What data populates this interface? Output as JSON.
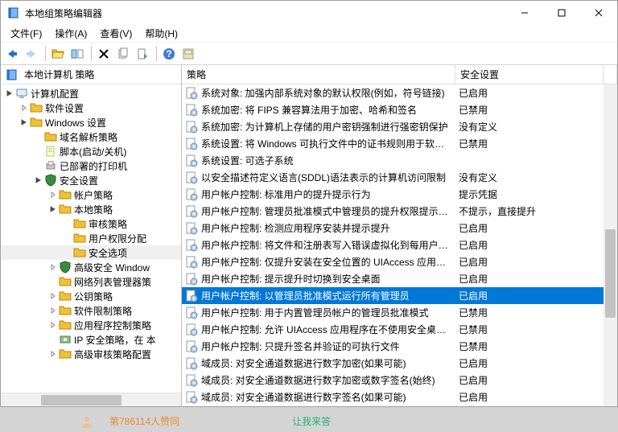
{
  "window": {
    "title": "本地组策略编辑器"
  },
  "menu": {
    "file": "文件(F)",
    "action": "操作(A)",
    "view": "查看(V)",
    "help": "帮助(H)"
  },
  "tree_header": "本地计算机 策略",
  "tree": {
    "root": "计算机配置",
    "software": "软件设置",
    "windows": "Windows 设置",
    "dns": "域名解析策略",
    "script": "脚本(启动/关机)",
    "printers": "已部署的打印机",
    "security": "安全设置",
    "account": "帐户策略",
    "local": "本地策略",
    "audit": "审核策略",
    "rights": "用户权限分配",
    "options": "安全选项",
    "advwin": "高级安全 Window",
    "netlist": "网络列表管理器策",
    "pubkey": "公钥策略",
    "softrest": "软件限制策略",
    "appctl": "应用程序控制策略",
    "ipsec": "IP 安全策略，在 本",
    "advaudit": "高级审核策略配置"
  },
  "headers": {
    "policy": "策略",
    "setting": "安全设置"
  },
  "policies": [
    {
      "name": "系统对象: 加强内部系统对象的默认权限(例如，符号链接)",
      "setting": "已启用"
    },
    {
      "name": "系统加密: 将 FIPS 兼容算法用于加密、哈希和签名",
      "setting": "已禁用"
    },
    {
      "name": "系统加密: 为计算机上存储的用户密钥强制进行强密钥保护",
      "setting": "没有定义"
    },
    {
      "name": "系统设置: 将 Windows 可执行文件中的证书规则用于软件...",
      "setting": "已禁用"
    },
    {
      "name": "系统设置: 可选子系统",
      "setting": ""
    },
    {
      "name": "以安全描述符定义语言(SDDL)语法表示的计算机访问限制",
      "setting": "没有定义"
    },
    {
      "name": "用户帐户控制: 标准用户的提升提示行为",
      "setting": "提示凭据"
    },
    {
      "name": "用户帐户控制: 管理员批准模式中管理员的提升权限提示的...",
      "setting": "不提示，直接提升"
    },
    {
      "name": "用户帐户控制: 检测应用程序安装并提示提升",
      "setting": "已启用"
    },
    {
      "name": "用户帐户控制: 将文件和注册表写入错误虚拟化到每用户位置",
      "setting": "已启用"
    },
    {
      "name": "用户帐户控制: 仅提升安装在安全位置的 UIAccess 应用程序",
      "setting": "已启用"
    },
    {
      "name": "用户帐户控制: 提示提升时切换到安全桌面",
      "setting": "已启用"
    },
    {
      "name": "用户帐户控制: 以管理员批准模式运行所有管理员",
      "setting": "已启用",
      "selected": true
    },
    {
      "name": "用户帐户控制: 用于内置管理员帐户的管理员批准模式",
      "setting": "已禁用"
    },
    {
      "name": "用户帐户控制: 允许 UIAccess 应用程序在不使用安全桌面...",
      "setting": "已禁用"
    },
    {
      "name": "用户帐户控制: 只提升签名并验证的可执行文件",
      "setting": "已禁用"
    },
    {
      "name": "域成员: 对安全通道数据进行数字加密(如果可能)",
      "setting": "已启用"
    },
    {
      "name": "域成员: 对安全通道数据进行数字加密或数字签名(始终)",
      "setting": "已启用"
    },
    {
      "name": "域成员: 对安全通道数据进行数字签名(如果可能)",
      "setting": "已启用"
    }
  ],
  "bottom": {
    "left": "第786114人赞同",
    "right": "让我来答"
  }
}
